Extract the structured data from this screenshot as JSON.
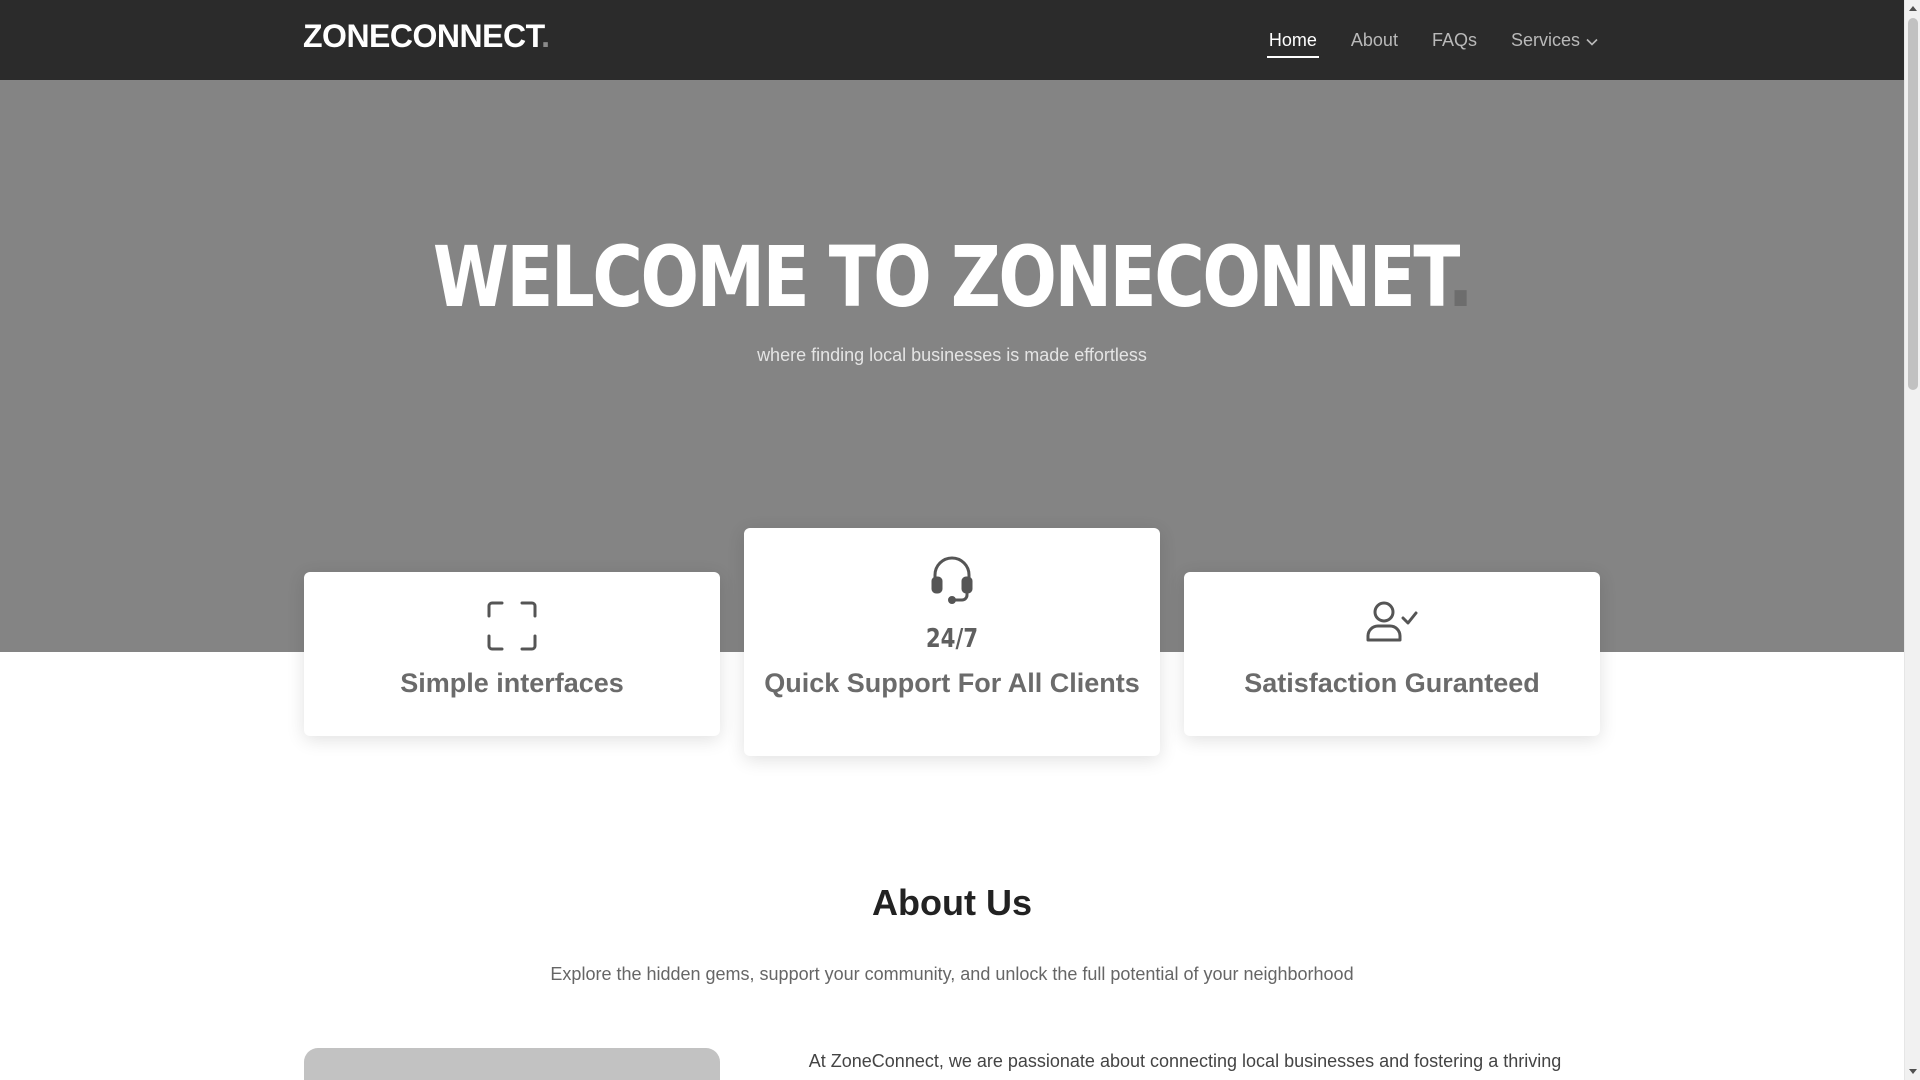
{
  "header": {
    "logo": "ZONECONNECT",
    "logo_dot": ".",
    "nav": [
      {
        "label": "Home"
      },
      {
        "label": "About"
      },
      {
        "label": "FAQs"
      },
      {
        "label": "Services"
      }
    ]
  },
  "hero": {
    "title": "WELCOME TO ZONECONNET",
    "title_dot": ".",
    "subtitle": "where finding local businesses is made effortless"
  },
  "features": [
    {
      "title": "Simple interfaces",
      "icon": "fullscreen-frame-icon"
    },
    {
      "stat": "24/7",
      "title": "Quick Support For All Clients",
      "icon": "headset-icon"
    },
    {
      "title": "Satisfaction Guranteed",
      "icon": "user-check-icon"
    }
  ],
  "about": {
    "title": "About Us",
    "subtitle": "Explore the hidden gems, support your community, and unlock the full potential of your neighborhood",
    "text": "At ZoneConnect, we are passionate about connecting local businesses and fostering a thriving"
  },
  "colors": {
    "header_bg": "#2b2b2b",
    "hero_bg": "#848484",
    "card_bg": "#ffffff"
  }
}
